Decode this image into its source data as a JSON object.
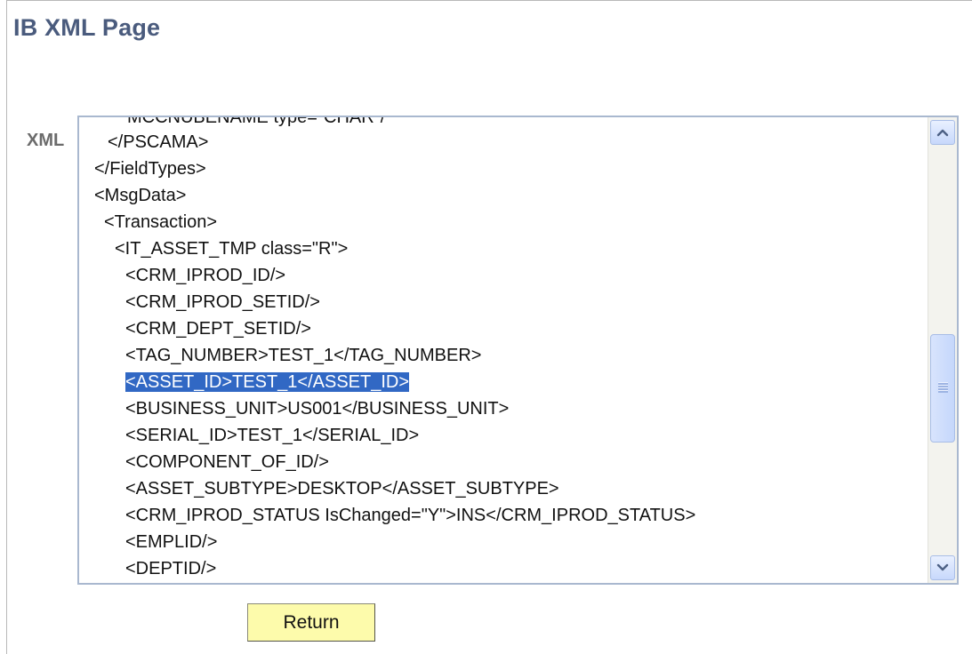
{
  "page": {
    "title": "IB XML Page"
  },
  "xml_field": {
    "label": "XML",
    "clipped_top_line": "MCCNUBENAME type=\"CHAR\"/",
    "lines": [
      "</PSCAMA>",
      "</FieldTypes>",
      "<MsgData>",
      "<Transaction>",
      "<IT_ASSET_TMP class=\"R\">",
      "<CRM_IPROD_ID/>",
      "<CRM_IPROD_SETID/>",
      "<CRM_DEPT_SETID/>",
      "<TAG_NUMBER>TEST_1</TAG_NUMBER>",
      "<ASSET_ID>TEST_1</ASSET_ID>",
      "<BUSINESS_UNIT>US001</BUSINESS_UNIT>",
      "<SERIAL_ID>TEST_1</SERIAL_ID>",
      "<COMPONENT_OF_ID/>",
      "<ASSET_SUBTYPE>DESKTOP</ASSET_SUBTYPE>",
      "<CRM_IPROD_STATUS IsChanged=\"Y\">INS</CRM_IPROD_STATUS>",
      "<EMPLID/>",
      "<DEPTID/>"
    ],
    "selected_line_index": 9,
    "scroll_position_fraction": 0.45
  },
  "actions": {
    "return_label": "Return"
  },
  "colors": {
    "title": "#4a5b7d",
    "selection": "#3168c4",
    "button_bg": "#fdfbab",
    "border": "#a9b8cf"
  },
  "icons": {
    "scroll_up": "chevron-up-icon",
    "scroll_down": "chevron-down-icon",
    "thumb_grip": "grip-icon"
  }
}
